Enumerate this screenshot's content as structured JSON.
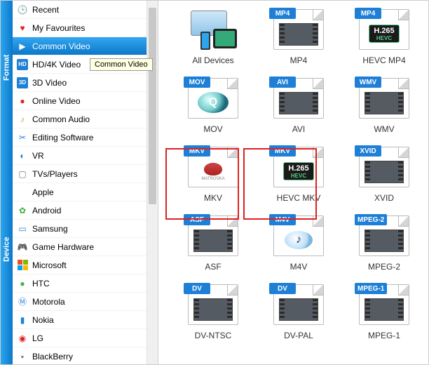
{
  "rails": {
    "format": "Format",
    "device": "Device"
  },
  "tooltip": "Common Video",
  "sidebar": {
    "format_items": [
      {
        "label": "Recent",
        "icon": "🕒",
        "cls": "ic-grey"
      },
      {
        "label": "My Favourites",
        "icon": "♥",
        "cls": "ic-red"
      },
      {
        "label": "Common Video",
        "icon": "▶",
        "cls": "",
        "selected": true
      },
      {
        "label": "HD/4K Video",
        "icon": "HD",
        "cls": "ic-blue"
      },
      {
        "label": "3D Video",
        "icon": "3D",
        "cls": "ic-blue"
      },
      {
        "label": "Online Video",
        "icon": "●",
        "cls": "ic-red"
      },
      {
        "label": "Common Audio",
        "icon": "♪",
        "cls": "ic-gold"
      }
    ],
    "device_items": [
      {
        "label": "Editing Software",
        "icon": "✂",
        "cls": "ic-blue"
      },
      {
        "label": "VR",
        "icon": "◐",
        "cls": "ic-blue"
      },
      {
        "label": "TVs/Players",
        "icon": "▢",
        "cls": "ic-grey"
      },
      {
        "label": "Apple",
        "icon": "",
        "cls": "ic-grey"
      },
      {
        "label": "Android",
        "icon": "✿",
        "cls": "ic-green"
      },
      {
        "label": "Samsung",
        "icon": "▭",
        "cls": "ic-blue"
      },
      {
        "label": "Game Hardware",
        "icon": "🎮",
        "cls": "ic-grey"
      },
      {
        "label": "Microsoft",
        "icon": "MS",
        "cls": ""
      },
      {
        "label": "HTC",
        "icon": "●",
        "cls": "ic-green"
      },
      {
        "label": "Motorola",
        "icon": "Ⓜ",
        "cls": "ic-blue"
      },
      {
        "label": "Nokia",
        "icon": "▮",
        "cls": "ic-blue"
      },
      {
        "label": "LG",
        "icon": "◉",
        "cls": "ic-red"
      },
      {
        "label": "BlackBerry",
        "icon": "▪",
        "cls": "ic-grey"
      }
    ]
  },
  "tiles": [
    {
      "id": "all-devices",
      "label": "All Devices",
      "type": "devices"
    },
    {
      "id": "mp4",
      "label": "MP4",
      "badge": "MP4",
      "badge_color": "#1e7fd6",
      "type": "film"
    },
    {
      "id": "hevc-mp4",
      "label": "HEVC MP4",
      "badge": "MP4",
      "badge_color": "#1e7fd6",
      "type": "h265"
    },
    {
      "id": "mov",
      "label": "MOV",
      "badge": "MOV",
      "badge_color": "#1e7fd6",
      "type": "qt"
    },
    {
      "id": "avi",
      "label": "AVI",
      "badge": "AVI",
      "badge_color": "#1e7fd6",
      "type": "film"
    },
    {
      "id": "wmv",
      "label": "WMV",
      "badge": "WMV",
      "badge_color": "#1e7fd6",
      "type": "film"
    },
    {
      "id": "mkv",
      "label": "MKV",
      "badge": "MKV",
      "badge_color": "#1e7fd6",
      "type": "matroska"
    },
    {
      "id": "hevc-mkv",
      "label": "HEVC MKV",
      "badge": "MKV",
      "badge_color": "#1e7fd6",
      "type": "h265"
    },
    {
      "id": "xvid",
      "label": "XVID",
      "badge": "XVID",
      "badge_color": "#1e7fd6",
      "type": "film"
    },
    {
      "id": "asf",
      "label": "ASF",
      "badge": "ASF",
      "badge_color": "#1e7fd6",
      "type": "film"
    },
    {
      "id": "m4v",
      "label": "M4V",
      "badge": "M4V",
      "badge_color": "#1e7fd6",
      "type": "note"
    },
    {
      "id": "mpeg2",
      "label": "MPEG-2",
      "badge": "MPEG-2",
      "badge_color": "#1e7fd6",
      "type": "film"
    },
    {
      "id": "dv-ntsc",
      "label": "DV-NTSC",
      "badge": "DV",
      "badge_color": "#1e7fd6",
      "type": "film"
    },
    {
      "id": "dv-pal",
      "label": "DV-PAL",
      "badge": "DV",
      "badge_color": "#1e7fd6",
      "type": "film"
    },
    {
      "id": "mpeg1",
      "label": "MPEG-1",
      "badge": "MPEG-1",
      "badge_color": "#1e7fd6",
      "type": "film"
    }
  ],
  "h265": {
    "top": "H.265",
    "bottom": "HEVC"
  },
  "matroska_label": "MATROSKA"
}
